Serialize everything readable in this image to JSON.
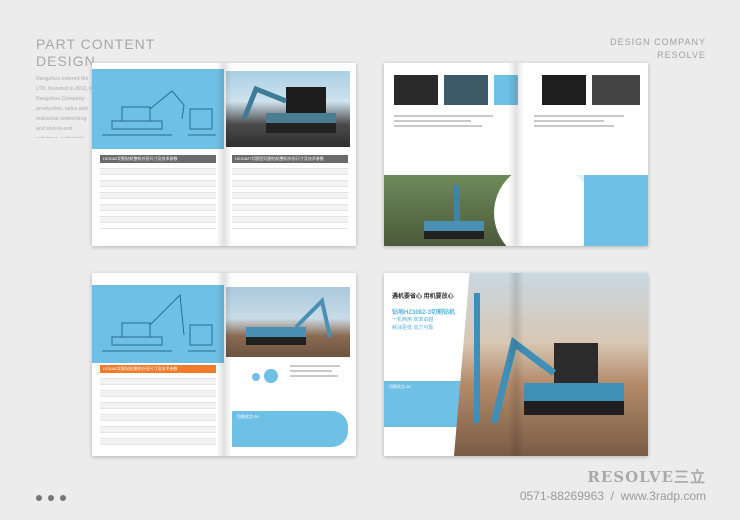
{
  "header": {
    "title_line1": "PART CONTENT",
    "title_line2": "DESIGN",
    "paragraph": "Hangzhou entered the LTD, founded in 2013, in Hangzhou Company production, sales and industrial networking and end-to-end solutions, industrial Ethernet and",
    "company_line1": "DESIGN COMPANY",
    "company_line2": "RESOLVE"
  },
  "spreads": {
    "s1": {
      "table_left_caption": "HZ308Z切割钻机整机外形尺寸及技术参数",
      "table_right_caption": "HZ308ZT切割型切割钻机整机外形尺寸及技术参数"
    },
    "s3": {
      "table_caption": "HZ308Z切割钻机整机外形尺寸及技术参数",
      "box_title": "切割优点 05"
    },
    "s4": {
      "headline": "遇机要省心 用机要放心",
      "product": "钻地HZ308Z-3切割钻机",
      "tag1": "一机两用  效率卓越",
      "tag2": "耗油更低  动力可靠",
      "box_title": "切割优点 04"
    }
  },
  "footer": {
    "brand": "RESOLVE三立",
    "phone": "0571-88269963",
    "website": "www.3radp.com"
  },
  "colors": {
    "accent": "#6fc0e6",
    "bg": "#ececec"
  }
}
